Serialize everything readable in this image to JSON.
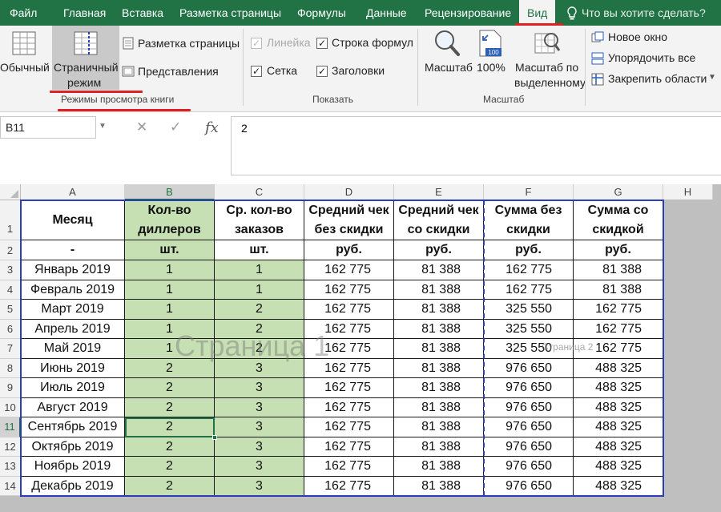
{
  "tabs": [
    {
      "label": "Файл"
    },
    {
      "label": "Главная"
    },
    {
      "label": "Вставка"
    },
    {
      "label": "Разметка страницы"
    },
    {
      "label": "Формулы"
    },
    {
      "label": "Данные"
    },
    {
      "label": "Рецензирование"
    },
    {
      "label": "Вид"
    }
  ],
  "tell_me": "Что вы хотите сделать?",
  "ribbon": {
    "view_modes": {
      "normal": "Обычный",
      "page_mode_line1": "Страничный",
      "page_mode_line2": "режим",
      "page_layout": "Разметка страницы",
      "custom_views": "Представления",
      "group_label": "Режимы просмотра книги"
    },
    "show": {
      "ruler": "Линейка",
      "formula_bar": "Строка формул",
      "gridlines": "Сетка",
      "headings": "Заголовки",
      "group_label": "Показать"
    },
    "zoom": {
      "zoom": "Масштаб",
      "zoom100": "100%",
      "zoom100_badge": "100",
      "zoom_sel_line1": "Масштаб по",
      "zoom_sel_line2": "выделенному",
      "group_label": "Масштаб"
    },
    "window": {
      "new_window": "Новое окно",
      "arrange_all": "Упорядочить все",
      "freeze_panes": "Закрепить области"
    }
  },
  "formula_bar": {
    "name_box": "B11",
    "cancel": "✕",
    "enter": "✓",
    "fx": "fx",
    "value": "2"
  },
  "sheet": {
    "columns": [
      "A",
      "B",
      "C",
      "D",
      "E",
      "F",
      "G",
      "H"
    ],
    "rows": [
      "1",
      "2",
      "3",
      "4",
      "5",
      "6",
      "7",
      "8",
      "9",
      "10",
      "11",
      "12",
      "13",
      "14"
    ],
    "header_row": [
      "Месяц",
      "Кол-во диллеров",
      "Ср. кол-во заказов",
      "Средний чек без скидки",
      "Средний чек со скидки",
      "Сумма без скидки",
      "Сумма со скидкой"
    ],
    "units_row": [
      "-",
      "шт.",
      "шт.",
      "руб.",
      "руб.",
      "руб.",
      "руб."
    ],
    "data": [
      [
        "Январь 2019",
        "1",
        "1",
        "162 775",
        "81 388",
        "162 775",
        "81 388"
      ],
      [
        "Февраль 2019",
        "1",
        "1",
        "162 775",
        "81 388",
        "162 775",
        "81 388"
      ],
      [
        "Март 2019",
        "1",
        "2",
        "162 775",
        "81 388",
        "325 550",
        "162 775"
      ],
      [
        "Апрель 2019",
        "1",
        "2",
        "162 775",
        "81 388",
        "325 550",
        "162 775"
      ],
      [
        "Май 2019",
        "1",
        "2",
        "162 775",
        "81 388",
        "325 550",
        "162 775"
      ],
      [
        "Июнь 2019",
        "2",
        "3",
        "162 775",
        "81 388",
        "976 650",
        "488 325"
      ],
      [
        "Июль 2019",
        "2",
        "3",
        "162 775",
        "81 388",
        "976 650",
        "488 325"
      ],
      [
        "Август 2019",
        "2",
        "3",
        "162 775",
        "81 388",
        "976 650",
        "488 325"
      ],
      [
        "Сентябрь 2019",
        "2",
        "3",
        "162 775",
        "81 388",
        "976 650",
        "488 325"
      ],
      [
        "Октябрь 2019",
        "2",
        "3",
        "162 775",
        "81 388",
        "976 650",
        "488 325"
      ],
      [
        "Ноябрь 2019",
        "2",
        "3",
        "162 775",
        "81 388",
        "976 650",
        "488 325"
      ],
      [
        "Декабрь 2019",
        "2",
        "3",
        "162 775",
        "81 388",
        "976 650",
        "488 325"
      ]
    ],
    "watermark_page1": "Страница 1",
    "watermark_page2": "Страница 2",
    "selected_cell": "B11",
    "colors": {
      "accent": "#217346",
      "highlight": "#c6e0b4",
      "page_border": "#2b3eb8",
      "annotation": "#e02020"
    }
  }
}
